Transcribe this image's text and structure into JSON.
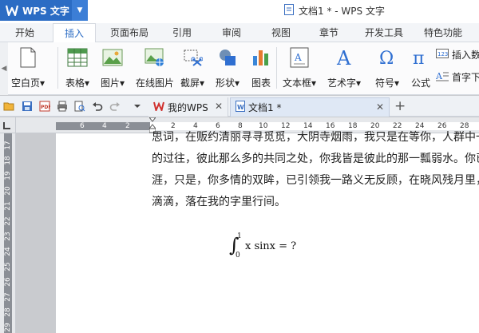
{
  "app": {
    "name": "WPS 文字",
    "title": "文档1 * - WPS 文字"
  },
  "menu_tabs": [
    "开始",
    "插入",
    "页面布局",
    "引用",
    "审阅",
    "视图",
    "章节",
    "开发工具",
    "特色功能"
  ],
  "active_tab": "插入",
  "ribbon": {
    "blank_page": "空白页",
    "table": "表格",
    "picture": "图片",
    "online_picture": "在线图片",
    "screenshot": "截屏",
    "shape": "形状",
    "chart": "图表",
    "textbox": "文本框",
    "art_text": "艺术字",
    "symbol": "符号",
    "formula": "公式",
    "insert_number": "插入数",
    "drop_cap": "首字下"
  },
  "doc_tabs": [
    {
      "label": "我的WPS"
    },
    {
      "label": "文档1 *"
    }
  ],
  "ruler": {
    "h_numbers": [
      "6",
      "4",
      "2",
      "2",
      "4",
      "6",
      "8",
      "10",
      "12",
      "14",
      "16",
      "18",
      "20",
      "22",
      "24",
      "26",
      "28"
    ],
    "v_numbers": [
      "17",
      "18",
      "19",
      "20",
      "21",
      "22",
      "23",
      "24",
      "25",
      "26",
      "27",
      "28",
      "29"
    ]
  },
  "document": {
    "lines": [
      "思词，在贩约清丽寻寻觅觅，大阴寺烟雨，我只是在等你，人群中一",
      "的过往，彼此那么多的共同之处，你我皆是彼此的那一瓢弱水。你已",
      "涯，只是，你多情的双眸，已引领我一路义无反顾，在晓风残月里，",
      "滴滴，落在我的字里行间。"
    ],
    "formula": {
      "upper": "1",
      "lower": "0",
      "expr": "x  sinx  = ?"
    }
  }
}
